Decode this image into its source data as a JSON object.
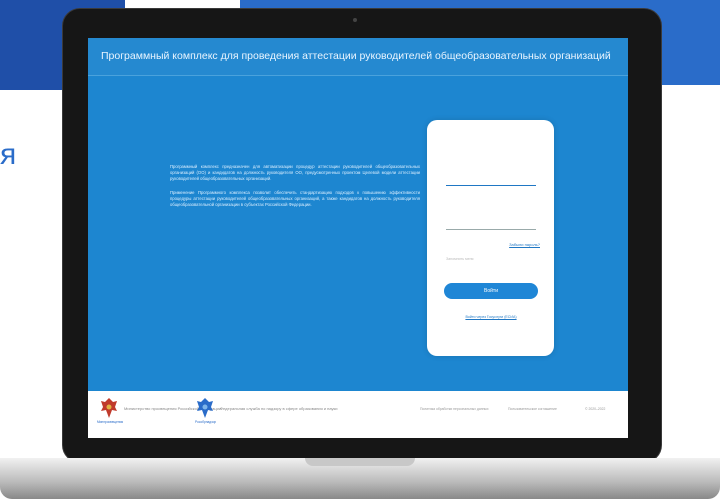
{
  "background": {
    "edge_letter": "я",
    "colors": {
      "dark_blue": "#1f4fa8",
      "blue": "#2a6cc9"
    }
  },
  "app": {
    "title": "Программный комплекс для проведения аттестации руководителей общеобразовательных организаций"
  },
  "main": {
    "description": [
      "Программный комплекс предназначен для автоматизации процедур аттестации руководителей общеобразовательных организаций (ОО) и кандидатов на должность руководителя ОО, предусмотренных проектом Целевой модели аттестации руководителей общеобразовательных организаций.",
      "Применение Программного комплекса позволит обеспечить стандартизацию подходов к повышению эффективности процедуры аттестации руководителей общеобразовательных организаций, а также кандидатов на должность руководителя общеобразовательной организации в субъектах Российской Федерации."
    ]
  },
  "login": {
    "login_value": "",
    "password_value": "",
    "forgot_password": "Забыли пароль?",
    "remember_me": "Запомнить меня",
    "submit_label": "Войти",
    "gosuslugi_link": "Войти через Госуслуги (ЕСИА)"
  },
  "footer": {
    "org1_caption": "Минпросвещения",
    "org1_text": "Министерство просвещения Российской Федерации",
    "org2_caption": "Рособрнадзор",
    "org2_text": "Федеральная служба по надзору в сфере образования и науки",
    "links": [
      "Политика обработки персональных данных",
      "Пользовательское соглашение",
      "© 2020–2022"
    ]
  },
  "colors": {
    "primary": "#1f87cf",
    "header": "#2589d0",
    "card": "#ffffff",
    "button": "#1f86d6"
  }
}
